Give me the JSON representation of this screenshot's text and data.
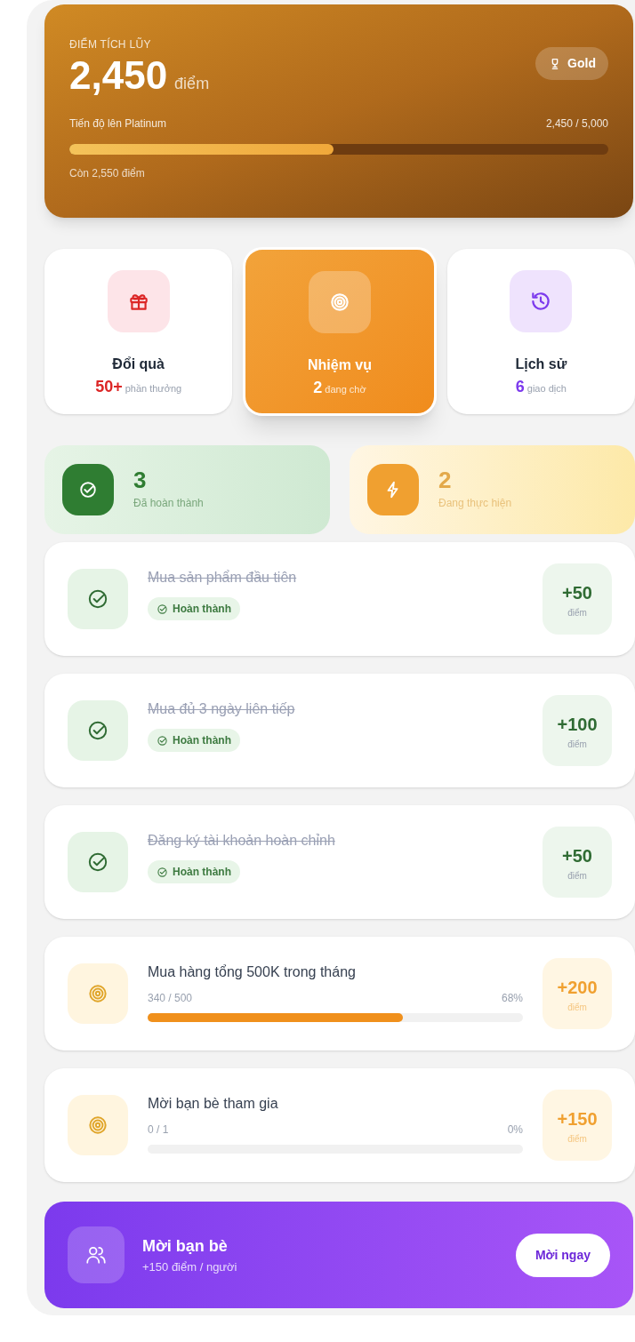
{
  "points_card": {
    "label": "ĐIỂM TÍCH LŨY",
    "points": "2,450",
    "unit": "điểm",
    "tier": "Gold",
    "progress_label": "Tiến độ lên Platinum",
    "progress_reading": "2,450 / 5,000",
    "level": 0.49,
    "remaining": "Còn 2,550 điểm"
  },
  "nav": [
    {
      "kind": "gift",
      "title": "Đổi quà",
      "count": "50+",
      "caption": "phần thưởng",
      "selected": false,
      "color": "#dc2626"
    },
    {
      "kind": "target",
      "title": "Nhiệm vụ",
      "count": "2",
      "caption": "đang chờ",
      "selected": true
    },
    {
      "kind": "history",
      "title": "Lịch sử",
      "count": "6",
      "caption": "giao dịch",
      "selected": false,
      "color": "#7c3aed"
    }
  ],
  "stats": [
    {
      "kind": "done",
      "count": "3",
      "label": "Đã hoàn thành"
    },
    {
      "kind": "active",
      "count": "2",
      "label": "Đang thực hiện"
    }
  ],
  "tasks": [
    {
      "kind": "done",
      "title": "Mua sản phẩm đầu tiên",
      "badge": "Hoàn thành",
      "reward": "+50",
      "unit": "điểm"
    },
    {
      "kind": "done",
      "title": "Mua đủ 3 ngày liên tiếp",
      "badge": "Hoàn thành",
      "reward": "+100",
      "unit": "điểm"
    },
    {
      "kind": "done",
      "title": "Đăng ký tài khoản hoàn chỉnh",
      "badge": "Hoàn thành",
      "reward": "+50",
      "unit": "điểm"
    },
    {
      "kind": "progress",
      "title": "Mua hàng tổng 500K trong tháng",
      "reading": "340 / 500",
      "percent": "68%",
      "level": 0.68,
      "reward": "+200",
      "unit": "điểm"
    },
    {
      "kind": "progress",
      "title": "Mời bạn bè tham gia",
      "reading": "0 / 1",
      "percent": "0%",
      "level": 0,
      "reward": "+150",
      "unit": "điểm"
    }
  ],
  "invite": {
    "title": "Mời bạn bè",
    "subtitle": "+150 điểm / người",
    "button": "Mời ngay"
  }
}
